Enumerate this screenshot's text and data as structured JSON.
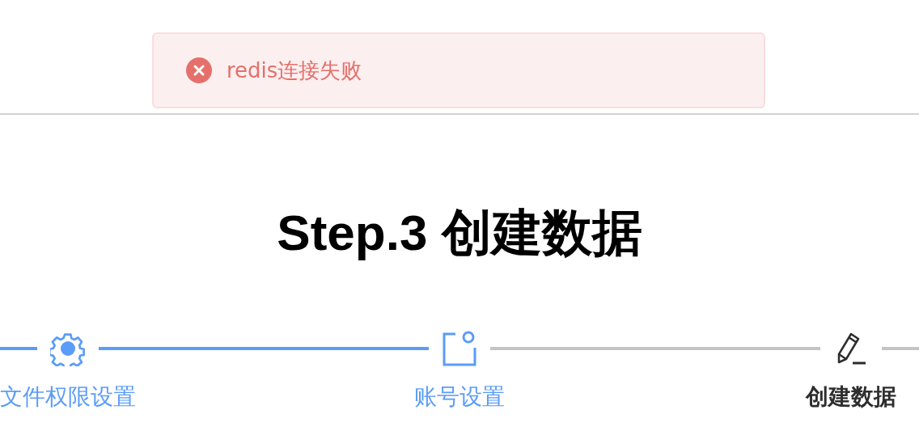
{
  "toast": {
    "kind": "error",
    "message": "redis连接失败"
  },
  "title": "Step.3 创建数据",
  "steps": [
    {
      "label": "文件权限设置",
      "finished": true,
      "selected": false
    },
    {
      "label": "账号设置",
      "finished": true,
      "selected": false
    },
    {
      "label": "创建数据",
      "finished": false,
      "selected": true
    }
  ]
}
